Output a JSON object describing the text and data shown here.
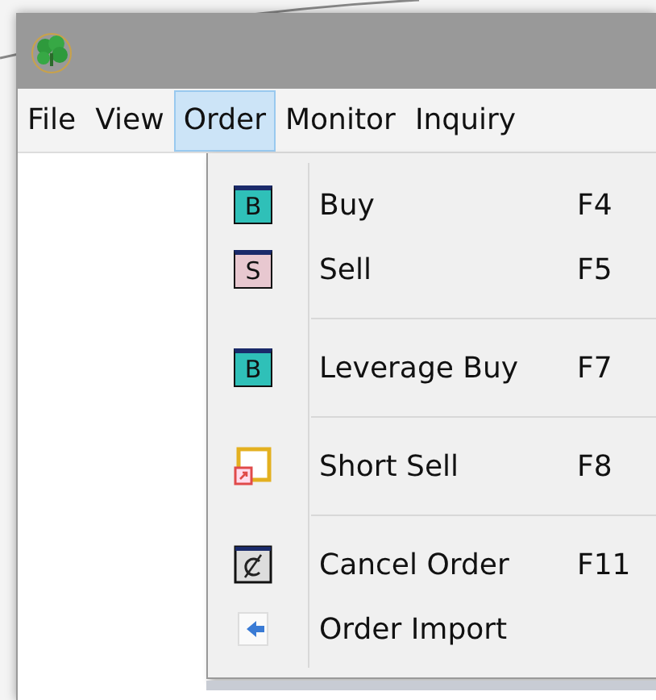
{
  "menu_bar": [
    {
      "label": "File",
      "selected": false
    },
    {
      "label": "View",
      "selected": false
    },
    {
      "label": "Order",
      "selected": true
    },
    {
      "label": "Monitor",
      "selected": false
    },
    {
      "label": "Inquiry",
      "selected": false
    }
  ],
  "dropdown": [
    {
      "kind": "buy",
      "badge": "B",
      "label": "Buy",
      "shortcut": "F4"
    },
    {
      "kind": "sell",
      "badge": "S",
      "label": "Sell",
      "shortcut": "F5"
    },
    {
      "kind": "separator"
    },
    {
      "kind": "buy",
      "badge": "B",
      "label": "Leverage Buy",
      "shortcut": "F7"
    },
    {
      "kind": "separator"
    },
    {
      "kind": "short",
      "label": "Short Sell",
      "shortcut": "F8"
    },
    {
      "kind": "separator"
    },
    {
      "kind": "cancel",
      "label": "Cancel Order",
      "shortcut": "F11"
    },
    {
      "kind": "import",
      "label": "Order Import"
    }
  ]
}
